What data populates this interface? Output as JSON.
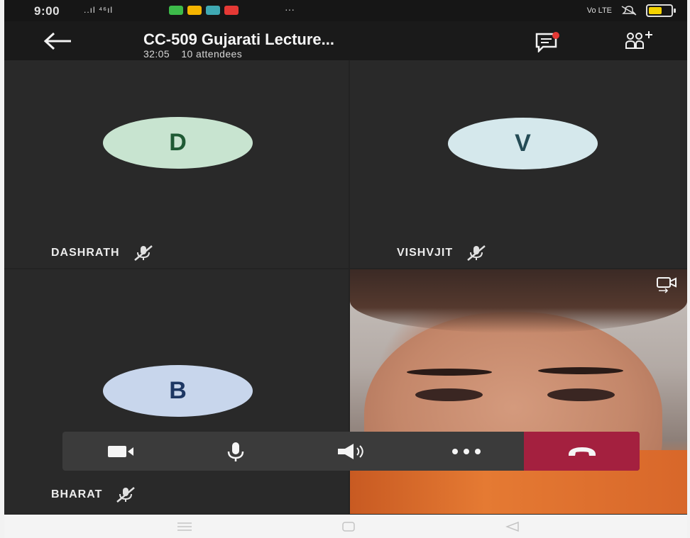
{
  "status_bar": {
    "time": "9:00",
    "signal_text": "..ıl ⁴⁶ıl",
    "more_indicator": "···",
    "network_label": "Vo LTE",
    "app_icon_colors": [
      "#3dbb4a",
      "#f4b400",
      "#3fa9b3",
      "#e53935"
    ]
  },
  "header": {
    "title": "CC-509 Gujarati Lecture...",
    "duration": "32:05",
    "attendees": "10 attendees",
    "chat_notification_color": "#e53935"
  },
  "participants": [
    {
      "initial": "D",
      "name": "DASHRATH",
      "avatar_color": "#c8e4d0",
      "initial_color": "#1f5a34",
      "muted": true
    },
    {
      "initial": "V",
      "name": "VISHVJIT",
      "avatar_color": "#d5e8ec",
      "initial_color": "#244b55",
      "muted": true
    },
    {
      "initial": "B",
      "name": "BHARAT",
      "avatar_color": "#c8d6ec",
      "initial_color": "#1d3763",
      "muted": true
    }
  ],
  "controls": {
    "items": [
      "camera-icon",
      "microphone-icon",
      "speaker-icon",
      "more-icon",
      "hang-up-icon"
    ],
    "end_call_color": "#a4203f"
  },
  "nav_bar": {
    "items": [
      "menu-icon",
      "home-icon",
      "back-triangle-icon"
    ]
  }
}
